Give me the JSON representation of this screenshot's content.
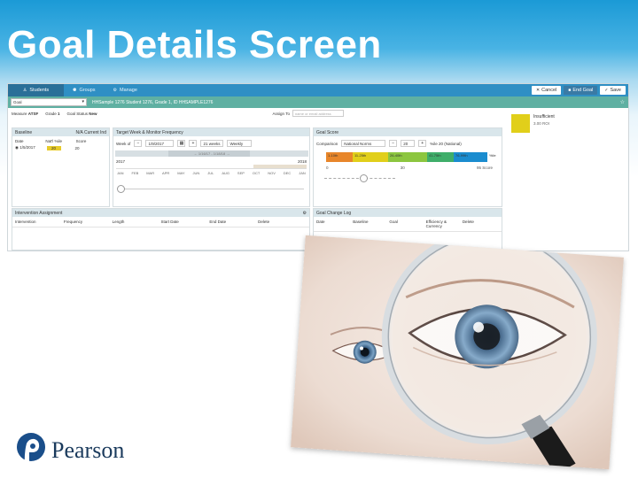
{
  "slide": {
    "title": "Goal Details Screen",
    "logo_text": "Pearson"
  },
  "nav": {
    "tabs": [
      {
        "label": "Students",
        "icon": "person-icon"
      },
      {
        "label": "Groups",
        "icon": "group-icon"
      },
      {
        "label": "Manage",
        "icon": "gears-icon"
      }
    ],
    "cancel": "Cancel",
    "end_goal": "End Goal",
    "save": "Save"
  },
  "student_bar": {
    "goal_select": "Goal",
    "student_info": "HHSample 1276 Student 1276, Grade 1, ID HHSAMPLE1276"
  },
  "measure_row": {
    "measure_label": "Measure",
    "measure_value": "ATSF",
    "grade_label": "Grade",
    "grade_value": "1",
    "status_label": "Goal Status",
    "status_value": "New",
    "assign_label": "Assign To",
    "assign_placeholder": "name or email address"
  },
  "status": {
    "label": "Insufficient",
    "sub": "3.00 ROI",
    "color": "#e1cf1a"
  },
  "baseline": {
    "title": "Baseline",
    "action": "N/A Current Ind",
    "columns": [
      "Date",
      "Nat'l %ile",
      "Score"
    ],
    "row": {
      "date": "1/5/2017",
      "pct": "20",
      "score": "20"
    }
  },
  "target": {
    "title": "Target Week & Monitor Frequency",
    "week_label": "Week of",
    "week_value": "1/9/2017",
    "weeks_value": "21 weeks",
    "freq_value": "Weekly",
    "range_text": "← 1/16/17 - 1/18/18 →",
    "year_start": "2017",
    "year_end": "2018",
    "months": [
      "JAN",
      "FEB",
      "MAR",
      "APR",
      "MAY",
      "JUN",
      "JUL",
      "AUG",
      "SEP",
      "OCT",
      "NOV",
      "DEC",
      "JAN"
    ]
  },
  "score": {
    "title": "Goal Score",
    "comparison_label": "Comparison",
    "comparison_value": "National Norms",
    "score_value": "20",
    "pct_value": "%ile 20 (National)",
    "bands": [
      {
        "label": "1-10th",
        "color": "#e8862a"
      },
      {
        "label": "11-25th",
        "color": "#e1cf1a"
      },
      {
        "label": "26-40th",
        "color": "#8cc63f"
      },
      {
        "label": "41-75th",
        "color": "#3fae6a"
      },
      {
        "label": "76-99th",
        "color": "#1a8ccf"
      }
    ],
    "axis_start": "0",
    "axis_mid": "30",
    "axis_end": "95 Score",
    "band_tail": "%ile",
    "band_n": "N"
  },
  "intervention": {
    "title": "Intervention Assignment",
    "columns": [
      "Intervention",
      "Frequency",
      "Length",
      "Start Date",
      "End Date",
      "Delete"
    ]
  },
  "changelog": {
    "title": "Goal Change Log",
    "columns": [
      "Date",
      "Baseline",
      "Goal",
      "Efficiency & Currency",
      "Delete"
    ]
  }
}
